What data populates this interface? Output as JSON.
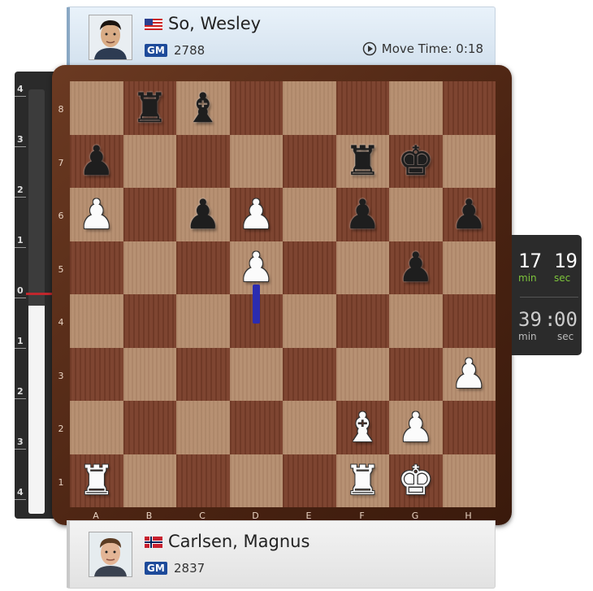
{
  "top_player": {
    "name": "So, Wesley",
    "title": "GM",
    "rating": "2788",
    "move_time": "Move Time: 0:18",
    "flag": "us-flag-icon"
  },
  "bottom_player": {
    "name": "Carlsen, Magnus",
    "title": "GM",
    "rating": "2837",
    "flag": "norway-flag-icon"
  },
  "eval_bar": {
    "labels": [
      "4",
      "3",
      "2",
      "1",
      "0",
      "1",
      "2",
      "3",
      "4"
    ],
    "white_fraction": 0.49
  },
  "clock": {
    "active": {
      "min": "17",
      "sec": "19",
      "min_label": "min",
      "sec_label": "sec"
    },
    "inactive": {
      "min": "39",
      "sep": ":",
      "sec": "00",
      "min_label": "min",
      "sec_label": "sec"
    },
    "colors": {
      "active_digits": "#ffffff",
      "active_units": "#7dc43b",
      "inactive": "#cccccc"
    }
  },
  "board": {
    "ranks": [
      "8",
      "7",
      "6",
      "5",
      "4",
      "3",
      "2",
      "1"
    ],
    "files": [
      "A",
      "B",
      "C",
      "D",
      "E",
      "F",
      "G",
      "H"
    ],
    "position": [
      [
        "",
        "bR",
        "bB",
        "",
        "",
        "",
        "",
        ""
      ],
      [
        "bP",
        "",
        "",
        "",
        "",
        "bR",
        "bK",
        ""
      ],
      [
        "wP",
        "",
        "bP",
        "wP",
        "",
        "bP",
        "",
        "bP"
      ],
      [
        "",
        "",
        "",
        "wP",
        "",
        "",
        "bP",
        ""
      ],
      [
        "",
        "",
        "",
        "",
        "",
        "",
        "",
        ""
      ],
      [
        "",
        "",
        "",
        "",
        "",
        "",
        "",
        "wP"
      ],
      [
        "",
        "",
        "",
        "",
        "",
        "wB",
        "wP",
        ""
      ],
      [
        "wR",
        "",
        "",
        "",
        "",
        "wR",
        "wK",
        ""
      ]
    ],
    "last_move": {
      "from": "d4",
      "to": "d5"
    },
    "colors": {
      "light": "#b58d6e",
      "dark": "#7a3f2a",
      "arrow": "#2b2cb0"
    }
  }
}
